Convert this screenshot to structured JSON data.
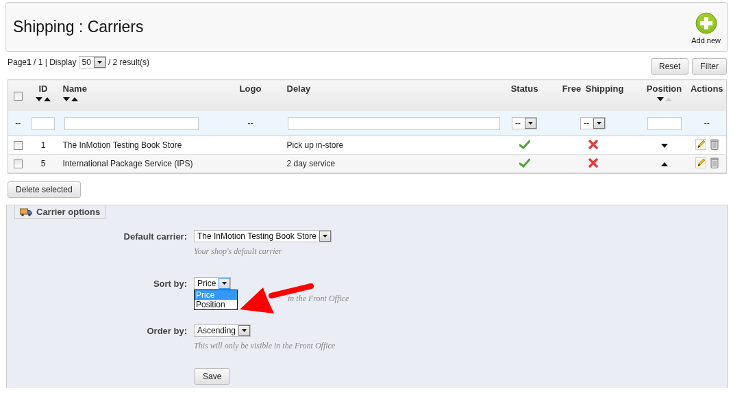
{
  "header": {
    "title": "Shipping : Carriers",
    "add_button": "Add new"
  },
  "pagination": {
    "text": "Page**1** / 1 | Display",
    "per_page": "50",
    "results": "/ 2 result(s)"
  },
  "filter_buttons": [
    "Reset",
    "Filter"
  ],
  "table": {
    "select_all": {
      "checked": false
    },
    "columns": [
      {
        "label": "ID",
        "sortable": true,
        "up_dimmed": false
      },
      {
        "label": "Name",
        "sortable": true,
        "up_dimmed": false
      },
      {
        "label": "Logo",
        "sortable": false
      },
      {
        "label": "Delay",
        "sortable": false
      },
      {
        "label": "Status",
        "sortable": false
      },
      {
        "label": "Free Shipping",
        "sortable": false
      },
      {
        "label": "Position",
        "sortable": true,
        "up_dimmed": true
      },
      {
        "label": "Actions",
        "sortable": false
      }
    ],
    "filters": [
      {
        "kind": "text",
        "text": "--"
      },
      {
        "kind": "input"
      },
      {
        "kind": "input"
      },
      {
        "kind": "text",
        "text": "--"
      },
      {
        "kind": "input"
      },
      {
        "kind": "select",
        "value": "--"
      },
      {
        "kind": "select",
        "value": "--"
      },
      {
        "kind": "input"
      },
      {
        "kind": "text",
        "text": "--"
      }
    ],
    "rows": [
      {
        "checked": false,
        "id": "1",
        "name": "The InMotion Testing Book Store",
        "delay": "Pick up in-store",
        "status": true,
        "free_shipping": false,
        "move_up": false
      },
      {
        "checked": false,
        "id": "5",
        "name": "International Package Service (IPS)",
        "delay": "2 day service",
        "status": true,
        "free_shipping": false,
        "move_up": true
      }
    ]
  },
  "delete_button": "Delete selected",
  "carrier_options": {
    "legend": "Carrier options",
    "fields": [
      {
        "label": "Default carrier:",
        "value": "The InMotion Testing Book Store",
        "hint": "Your shop's default carrier"
      },
      {
        "label": "Sort by:",
        "value": "Price",
        "expanded": true,
        "options": [
          {
            "label": "Price",
            "selected": true
          },
          {
            "label": "Position",
            "selected": false
          }
        ],
        "hint": "in the Front Office"
      },
      {
        "label": "Order by:",
        "value": "Ascending",
        "hint": "This will only be visible in the Front Office"
      }
    ],
    "save_button": "Save"
  }
}
